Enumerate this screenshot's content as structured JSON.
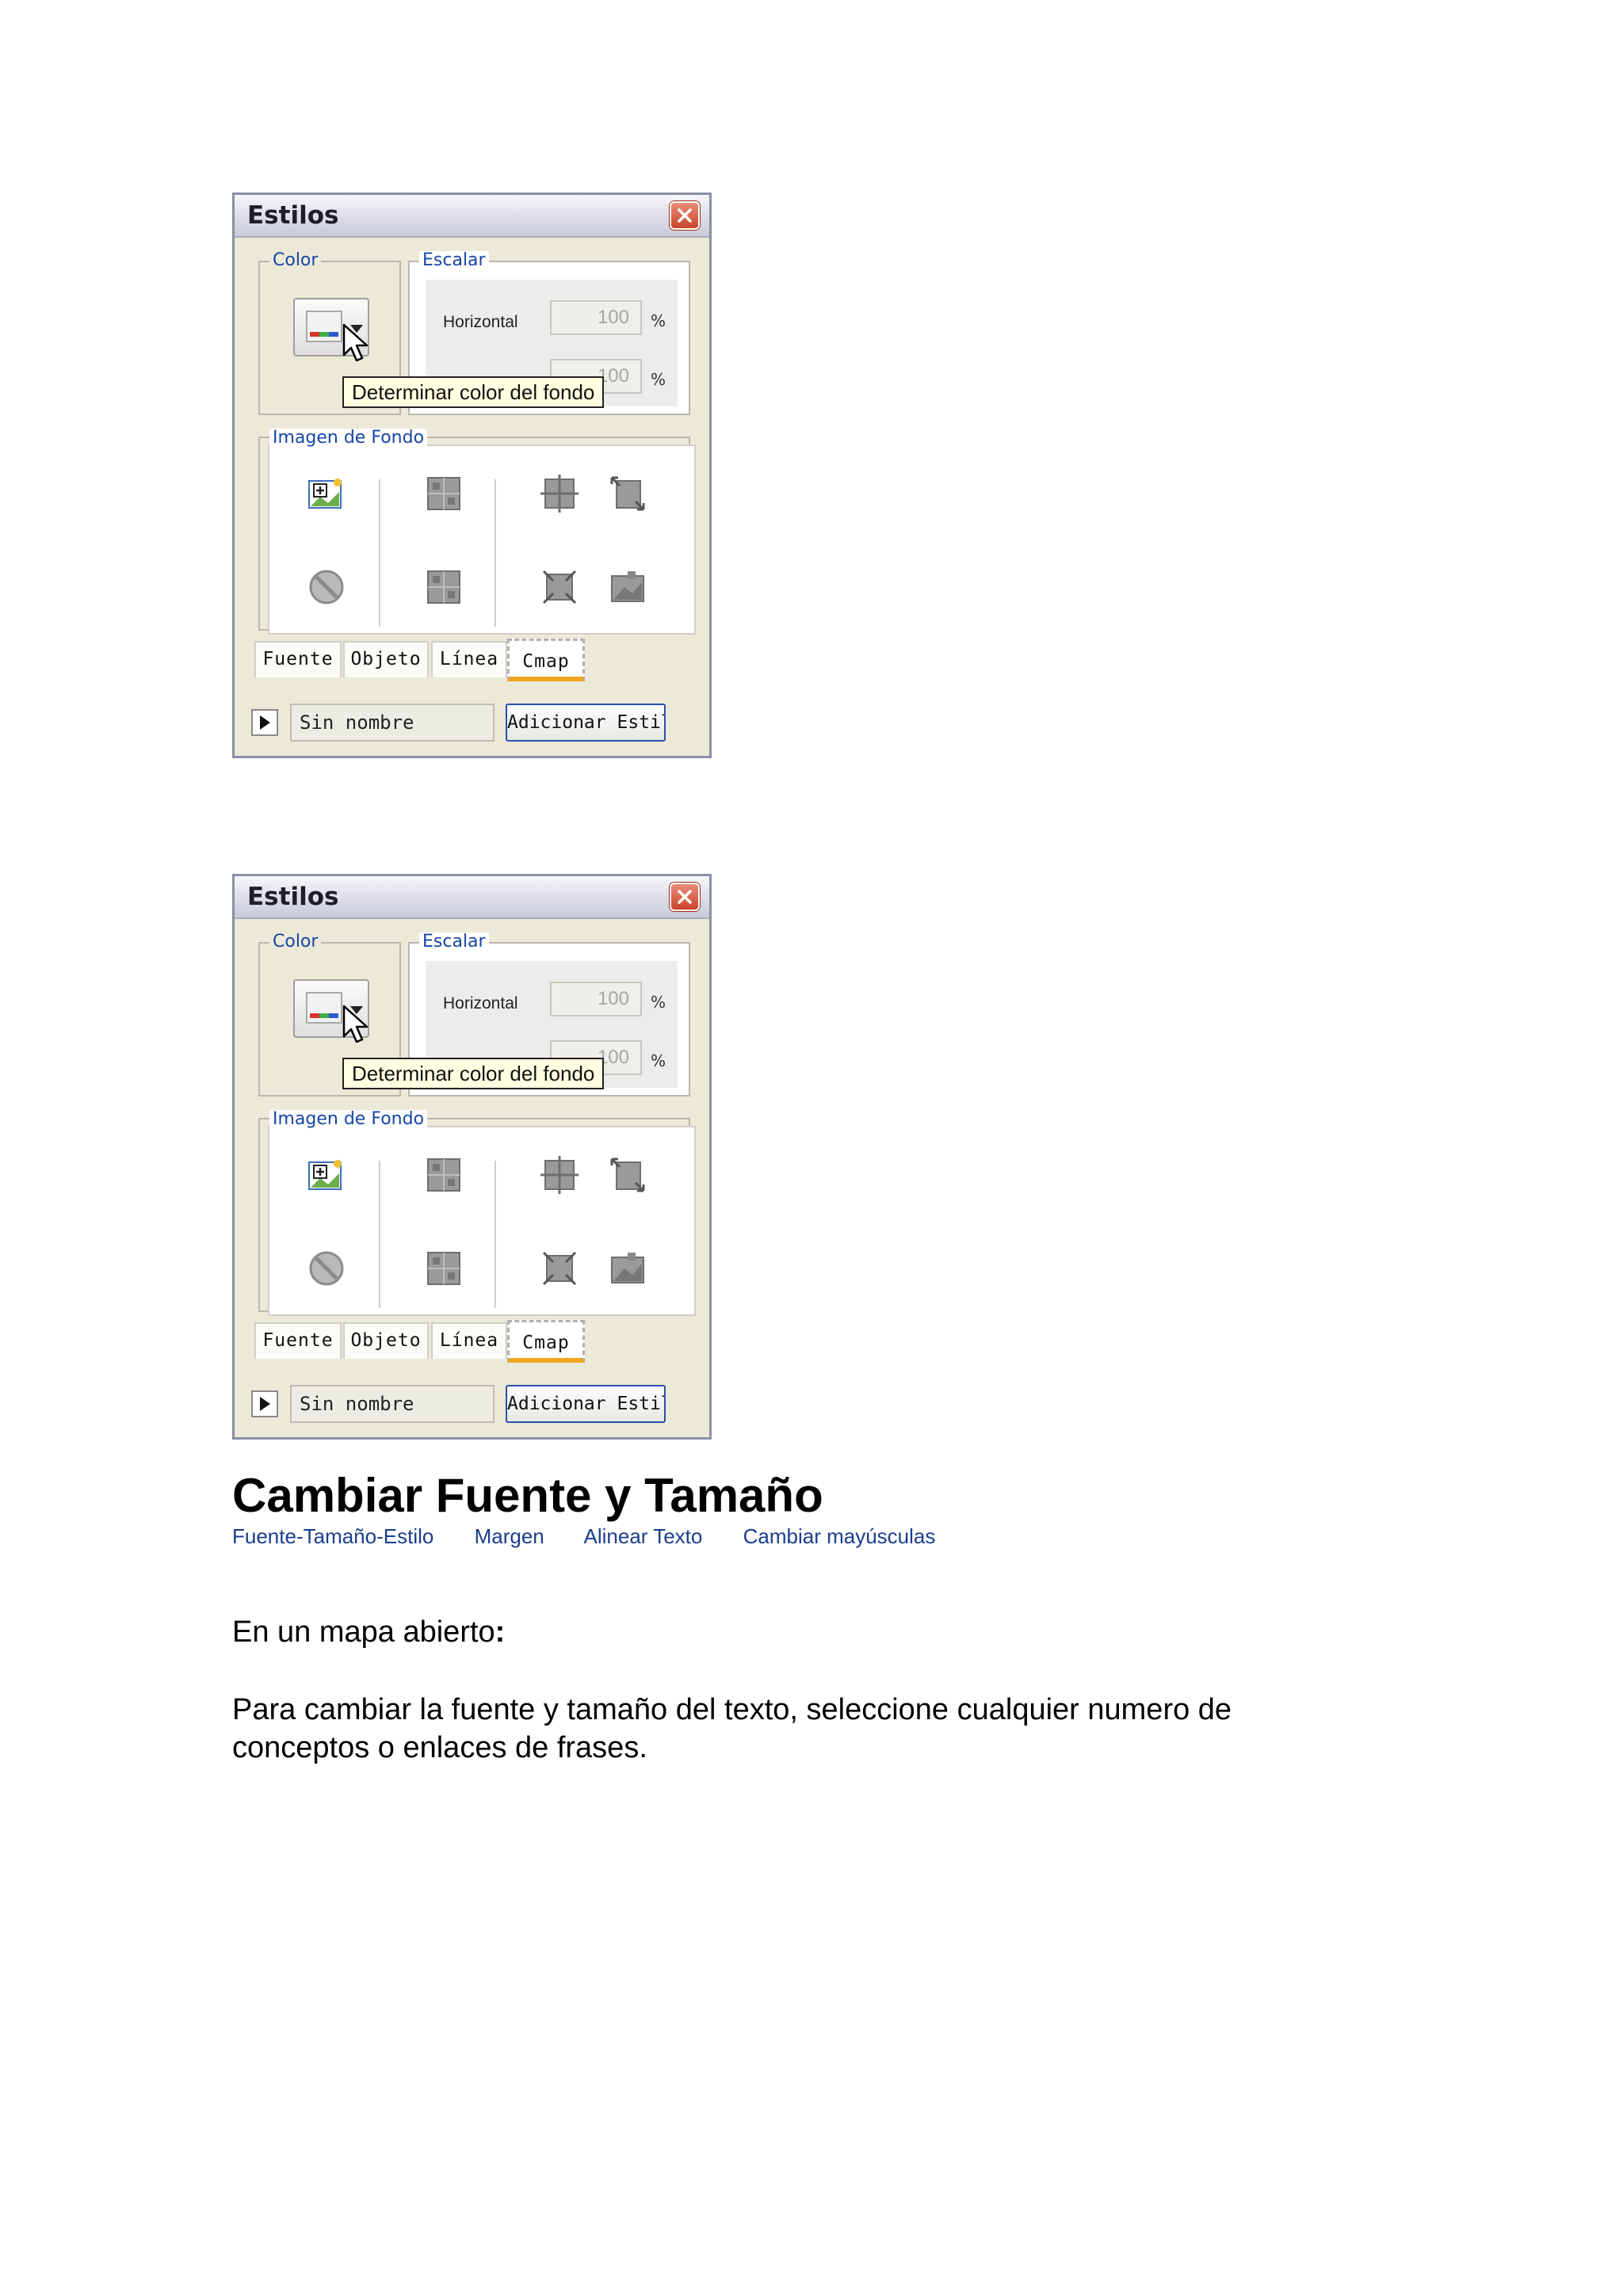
{
  "dialogs": [
    {
      "title": "Estilos",
      "color_group": {
        "label": "Color"
      },
      "escalar_group": {
        "label": "Escalar",
        "horizontal_label": "Horizontal",
        "horizontal_value": "100",
        "vertical_value": "100",
        "percent": "%"
      },
      "tooltip": "Determinar color del fondo",
      "imagen_group": {
        "label": "Imagen de Fondo"
      },
      "tabs": [
        "Fuente",
        "Objeto",
        "Línea",
        "Cmap"
      ],
      "active_tab": "Cmap",
      "style_name": "Sin nombre",
      "add_button": "Adicionar Estilo"
    },
    {
      "title": "Estilos",
      "color_group": {
        "label": "Color"
      },
      "escalar_group": {
        "label": "Escalar",
        "horizontal_label": "Horizontal",
        "horizontal_value": "100",
        "vertical_value": "100",
        "percent": "%"
      },
      "tooltip": "Determinar color del fondo",
      "imagen_group": {
        "label": "Imagen de Fondo"
      },
      "tabs": [
        "Fuente",
        "Objeto",
        "Línea",
        "Cmap"
      ],
      "active_tab": "Cmap",
      "style_name": "Sin nombre",
      "add_button": "Adicionar Estilo"
    }
  ],
  "icons": {
    "close": "close-icon",
    "add_image": "add-image-icon",
    "remove_image": "no-image-icon",
    "tile": "tile-icon",
    "center": "center-image-icon",
    "stretch": "stretch-image-icon",
    "fit": "fit-image-icon",
    "fill": "fill-image-icon"
  },
  "colors": {
    "dialog_bg": "#ece9d8",
    "group_label": "#1746a6",
    "tooltip_bg": "#ffffe1",
    "active_tab_accent": "#f2a520",
    "link": "#1a3e8c"
  },
  "document": {
    "heading": "Cambiar Fuente y Tamaño",
    "links": [
      "Fuente-Tamaño-Estilo",
      "Margen",
      "Alinear Texto",
      "Cambiar mayúsculas"
    ],
    "intro": "En un mapa abierto",
    "intro_colon": ":",
    "body": "Para cambiar la fuente y tamaño del texto, seleccione cualquier numero de conceptos o enlaces de frases."
  }
}
